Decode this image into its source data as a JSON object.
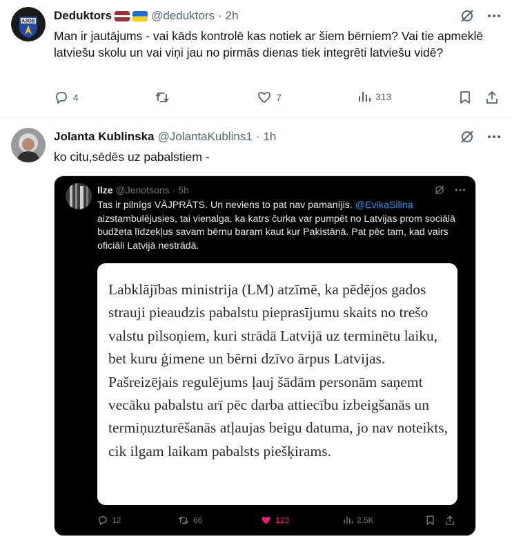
{
  "tweet1": {
    "author_name": "Deduktors",
    "flags": [
      "latvia-flag",
      "ukraine-flag"
    ],
    "handle": "@deduktors",
    "separator": "·",
    "time": "2h",
    "avatar_text": "A3OB",
    "text": "Man ir jautājums - vai kāds kontrolē kas notiek ar šiem bērniem? Vai tie apmeklē latviešu skolu un vai viņi jau no pirmās dienas tiek integrēti latviešu vidē?",
    "replies": "4",
    "reposts": "",
    "likes": "7",
    "views": "313"
  },
  "tweet2": {
    "author_name": "Jolanta Kublinska",
    "handle": "@JolantaKublins1",
    "separator": "·",
    "time": "1h",
    "text": "ko citu,sēdēs uz pabalstiem -",
    "embedded": {
      "author_name": "Ilze",
      "handle": "@Jenotsons",
      "separator": "·",
      "time": "5h",
      "text_before_mention": "Tas ir pilnīgs VĀJPRĀTS. Un neviens to pat nav pamanījis. ",
      "mention": "@EvikaSilina",
      "text_after_mention": " aizstambulējusies, tai vienalga, ka katrs čurka var pumpēt no Latvijas prom sociālā budžeta līdzekļus savam bērnu baram kaut kur Pakistānā. Pat pēc tam, kad vairs oficiāli Latvijā nestrādā.",
      "card_text": "Labklājības ministrija (LM) atzīmē, ka pēdējos gados strauji pieaudzis pabalstu pieprasījumu skaits no trešo valstu pilsoņiem, kuri strādā Latvijā uz terminētu laiku, bet kuru ģimene un bērni dzīvo ārpus Latvijas. Pašreizējais regulējums ļauj šādām personām saņemt vecāku pabalstu arī pēc darba attiecību izbeigšanās un termiņuzturēšanās atļaujas beigu datuma, jo nav noteikts, cik ilgam laikam pabalsts piešķirams.",
      "replies": "12",
      "reposts": "66",
      "likes": "123",
      "views": "2.5K"
    }
  },
  "colors": {
    "text_primary": "#0f1419",
    "text_secondary": "#536471",
    "like_pink": "#f91880",
    "link_blue": "#1d9bf0",
    "embed_bg": "#000000"
  },
  "icons": [
    "grok-icon",
    "more-icon",
    "reply-icon",
    "repost-icon",
    "like-icon",
    "views-icon",
    "bookmark-icon",
    "share-icon"
  ]
}
